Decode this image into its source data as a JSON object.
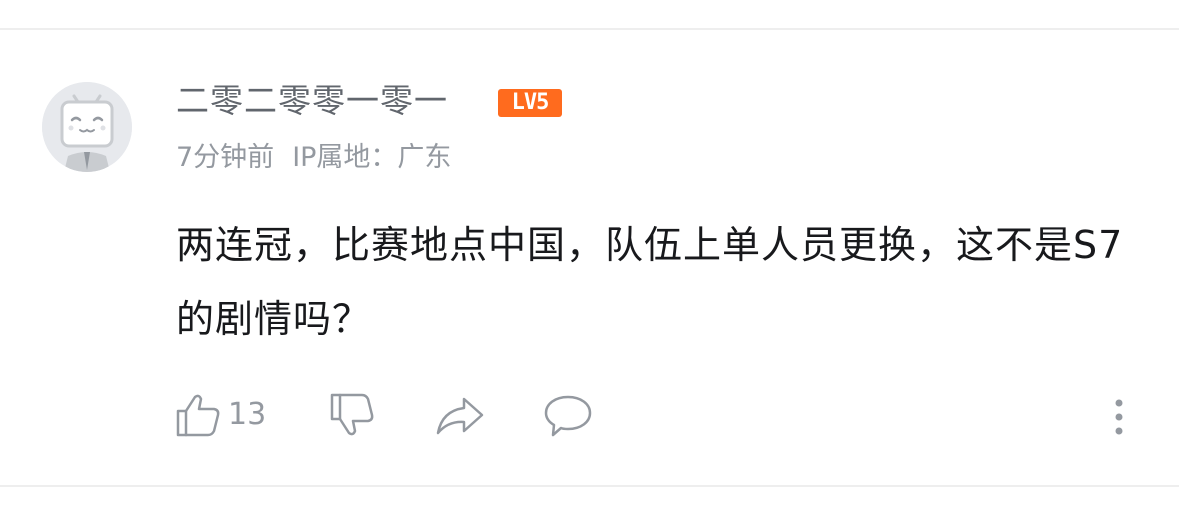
{
  "comment": {
    "username": "二零二零零一零一",
    "level_badge": "LV5",
    "time": "7分钟前",
    "ip_location": "IP属地：广东",
    "text": "两连冠，比赛地点中国，队伍上单人员更换，这不是S7的剧情吗？",
    "likes": "13"
  },
  "colors": {
    "badge": "#ff6b1e",
    "secondary_text": "#9499a0",
    "username": "#61666d",
    "body_text": "#18191c"
  },
  "icons": {
    "avatar": "bilibili-tv-avatar-icon",
    "like": "thumbs-up-icon",
    "dislike": "thumbs-down-icon",
    "share": "share-arrow-icon",
    "reply": "speech-bubble-icon",
    "more": "vertical-ellipsis-icon"
  }
}
